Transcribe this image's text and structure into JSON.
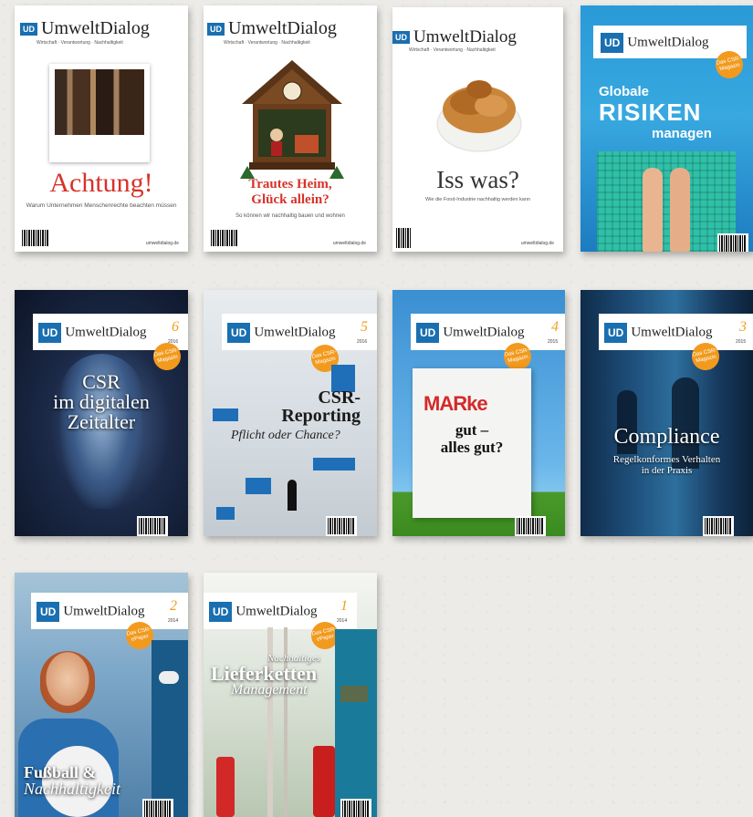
{
  "brand": {
    "logo": "UD",
    "name": "UmweltDialog",
    "tagline": "Wirtschaft · Verantwortung · Nachhaltigkeit",
    "site": "umweltdialog.de"
  },
  "covers": [
    {
      "title": "Achtung!",
      "subtitle": "Warum Unternehmen Menschenrechte beachten müssen"
    },
    {
      "title_line1": "Trautes Heim,",
      "title_line2": "Glück allein?",
      "subtitle": "So können wir nachhaltig bauen und wohnen"
    },
    {
      "title": "Iss was?",
      "subtitle": "Wie die Food-Industrie nachhaltig werden kann"
    },
    {
      "title_line1": "Globale",
      "title_line2": "RISIKEN",
      "title_line3": "managen",
      "badge": "Das CSR-Magazin"
    },
    {
      "issue": "6",
      "year": "2016",
      "title_line1": "CSR",
      "title_line2": "im digitalen",
      "title_line3": "Zeitalter",
      "badge": "Das CSR-Magazin"
    },
    {
      "issue": "5",
      "year": "2016",
      "title_line1": "CSR-",
      "title_line2": "Reporting",
      "subtitle": "Pflicht oder Chance?",
      "badge": "Das CSR-Magazin"
    },
    {
      "issue": "4",
      "year": "2015",
      "title_line1": "MARke",
      "title_line2": "gut –",
      "title_line3": "alles gut?",
      "badge": "Das CSR-Magazin"
    },
    {
      "issue": "3",
      "year": "2015",
      "title": "Compliance",
      "subtitle_line1": "Regelkonformes Verhalten",
      "subtitle_line2": "in der Praxis",
      "badge": "Das CSR-Magazin"
    },
    {
      "issue": "2",
      "year": "2014",
      "title_line1": "Fußball &",
      "title_line2": "Nachhaltigkeit",
      "badge": "Das CSR-ePaper"
    },
    {
      "issue": "1",
      "year": "2014",
      "title_line1": "Nachhaltiges",
      "title_line2": "Lieferketten",
      "title_line3": "Management",
      "badge": "Das CSR-ePaper"
    }
  ]
}
